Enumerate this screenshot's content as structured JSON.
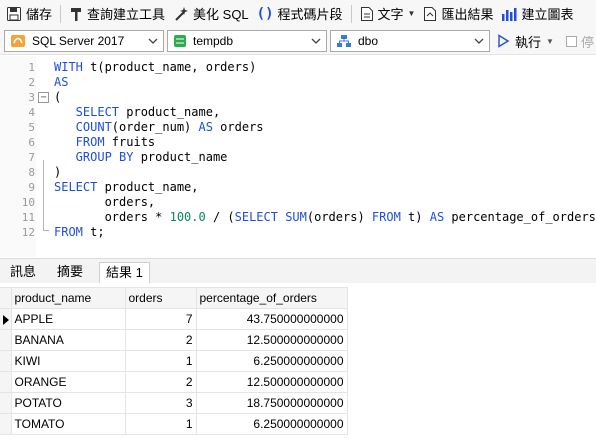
{
  "toolbar": {
    "save": "儲存",
    "query_builder": "查詢建立工具",
    "beautify": "美化 SQL",
    "snippet": "程式碼片段",
    "text": "文字",
    "export": "匯出結果",
    "chart": "建立圖表"
  },
  "connection": {
    "server": "SQL Server 2017",
    "database": "tempdb",
    "schema": "dbo",
    "run": "執行",
    "stop": "停"
  },
  "code_lines": [
    {
      "n": "1",
      "tokens": [
        {
          "t": "WITH",
          "c": "kw"
        },
        {
          "t": " t(product_name, orders)",
          "c": ""
        }
      ]
    },
    {
      "n": "2",
      "tokens": [
        {
          "t": "AS",
          "c": "kw"
        }
      ]
    },
    {
      "n": "3",
      "tokens": [
        {
          "t": "(",
          "c": ""
        }
      ]
    },
    {
      "n": "4",
      "tokens": [
        {
          "t": "   SELECT",
          "c": "kw"
        },
        {
          "t": " product_name,",
          "c": ""
        }
      ]
    },
    {
      "n": "5",
      "tokens": [
        {
          "t": "   COUNT",
          "c": "kw"
        },
        {
          "t": "(order_num) ",
          "c": ""
        },
        {
          "t": "AS",
          "c": "kw"
        },
        {
          "t": " orders",
          "c": ""
        }
      ]
    },
    {
      "n": "6",
      "tokens": [
        {
          "t": "   FROM",
          "c": "kw"
        },
        {
          "t": " fruits",
          "c": ""
        }
      ]
    },
    {
      "n": "7",
      "tokens": [
        {
          "t": "   GROUP BY",
          "c": "kw"
        },
        {
          "t": " product_name",
          "c": ""
        }
      ]
    },
    {
      "n": "8",
      "tokens": [
        {
          "t": ")",
          "c": ""
        }
      ]
    },
    {
      "n": "9",
      "tokens": [
        {
          "t": "SELECT",
          "c": "kw"
        },
        {
          "t": " product_name,",
          "c": ""
        }
      ]
    },
    {
      "n": "10",
      "tokens": [
        {
          "t": "       orders,",
          "c": ""
        }
      ]
    },
    {
      "n": "11",
      "tokens": [
        {
          "t": "       orders * ",
          "c": ""
        },
        {
          "t": "100.0",
          "c": "num"
        },
        {
          "t": " / (",
          "c": ""
        },
        {
          "t": "SELECT SUM",
          "c": "kw"
        },
        {
          "t": "(orders) ",
          "c": ""
        },
        {
          "t": "FROM",
          "c": "kw"
        },
        {
          "t": " t) ",
          "c": ""
        },
        {
          "t": "AS",
          "c": "kw"
        },
        {
          "t": " percentage_of_orders",
          "c": ""
        }
      ]
    },
    {
      "n": "12",
      "tokens": [
        {
          "t": "FROM",
          "c": "kw"
        },
        {
          "t": " t;",
          "c": ""
        }
      ]
    }
  ],
  "tabs": [
    "訊息",
    "摘要",
    "結果 1"
  ],
  "results": {
    "columns": [
      "product_name",
      "orders",
      "percentage_of_orders"
    ],
    "rows": [
      [
        "APPLE",
        "7",
        "43.750000000000"
      ],
      [
        "BANANA",
        "2",
        "12.500000000000"
      ],
      [
        "KIWI",
        "1",
        "6.250000000000"
      ],
      [
        "ORANGE",
        "2",
        "12.500000000000"
      ],
      [
        "POTATO",
        "3",
        "18.750000000000"
      ],
      [
        "TOMATO",
        "1",
        "6.250000000000"
      ]
    ]
  },
  "colors": {
    "keyword": "#1f4fd8",
    "number": "#09885a",
    "line_number": "#9a9a9a"
  }
}
